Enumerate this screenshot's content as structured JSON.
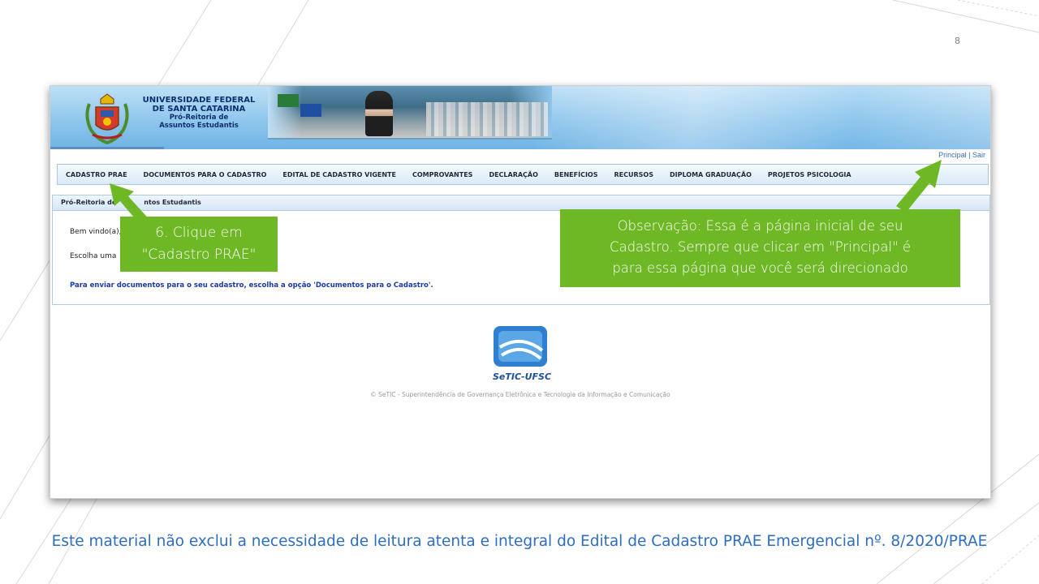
{
  "slide": {
    "page_number": "8",
    "disclaimer": "Este material não exclui a necessidade de leitura atenta e integral do Edital de Cadastro PRAE Emergencial nº. 8/2020/PRAE"
  },
  "banner": {
    "line1": "UNIVERSIDADE FEDERAL",
    "line2": "DE SANTA CATARINA",
    "line3": "Pró-Reitoria de",
    "line4": "Assuntos Estudantis"
  },
  "toplinks": {
    "principal": "Principal",
    "separator": " | ",
    "sair": "Sair"
  },
  "menu": [
    {
      "label": "CADASTRO PRAE"
    },
    {
      "label": "DOCUMENTOS PARA O CADASTRO"
    },
    {
      "label": "EDITAL DE CADASTRO VIGENTE"
    },
    {
      "label": "COMPROVANTES"
    },
    {
      "label": "DECLARAÇÃO"
    },
    {
      "label": "BENEFÍCIOS"
    },
    {
      "label": "RECURSOS"
    },
    {
      "label": "DIPLOMA GRADUAÇÃO"
    },
    {
      "label": "PROJETOS PSICOLOGIA"
    }
  ],
  "panel": {
    "header_left": "Pró-Reitoria de",
    "header_right": "ntos Estudantis",
    "welcome": "Bem vindo(a),",
    "choose": "Escolha uma",
    "info": "Para enviar documentos para o seu cadastro, escolha a opção 'Documentos para o Cadastro'."
  },
  "footer": {
    "logo_text": "SeTIC-UFSC",
    "copyright": "© SeTIC - Superintendência de Governança Eletrônica e Tecnologia da Informação e Comunicação"
  },
  "callouts": {
    "step6_line1": "6. Clique em",
    "step6_line2": "\"Cadastro PRAE\"",
    "obs_line1": "Observação: Essa é a página inicial de seu",
    "obs_line2": "Cadastro. Sempre que clicar em \"Principal\" é",
    "obs_line3": "para essa página que você será direcionado"
  },
  "colors": {
    "callout_green": "#6fb825",
    "disclaimer_blue": "#2f6ebd",
    "link_blue": "#3b6fb0"
  }
}
